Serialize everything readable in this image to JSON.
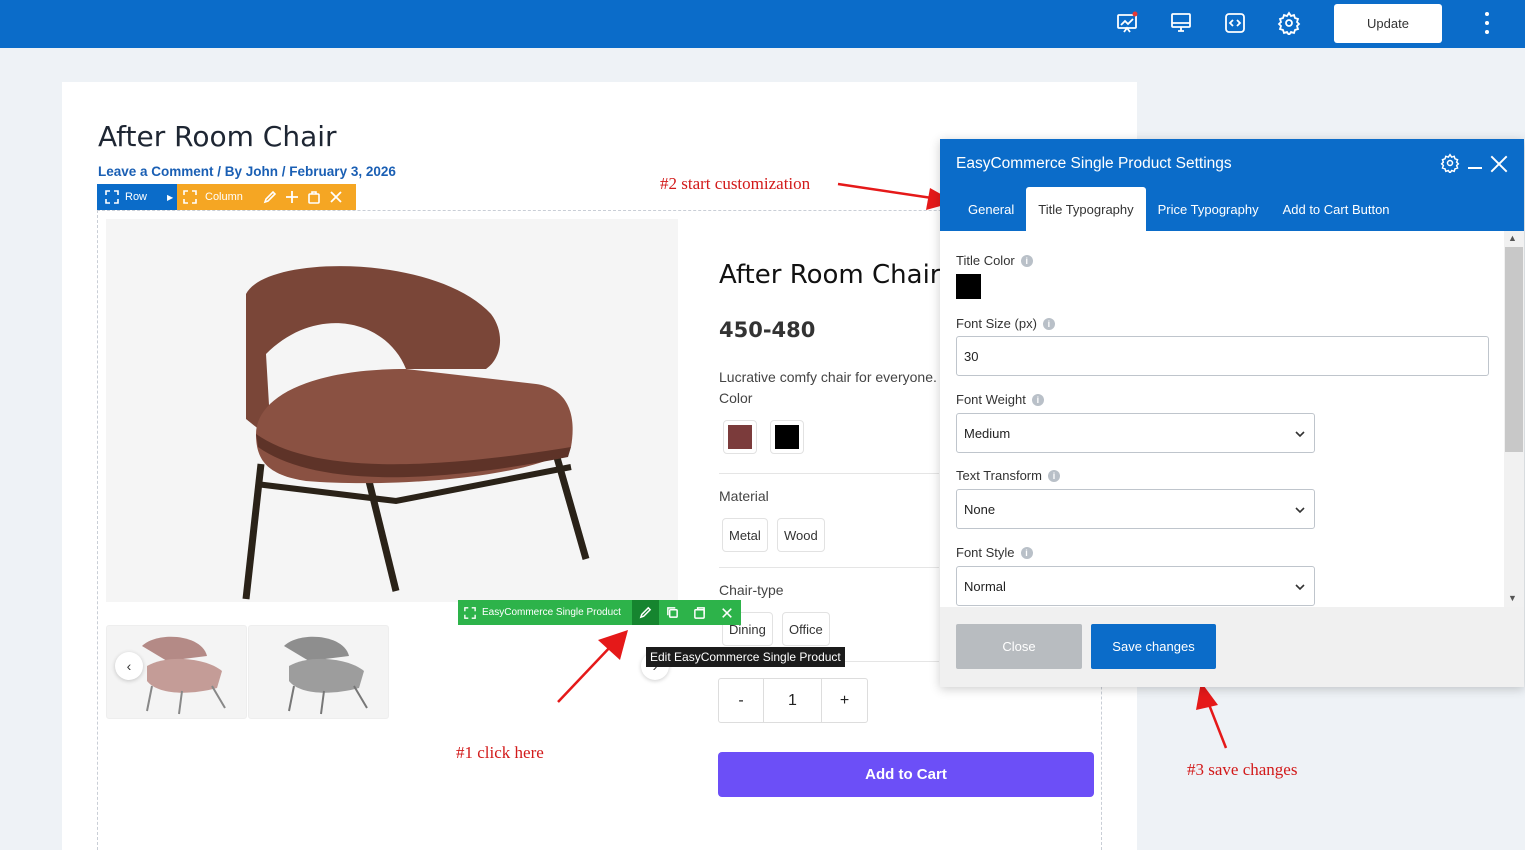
{
  "topbar": {
    "icons": [
      "analytics-icon",
      "desktop-preview-icon",
      "code-icon",
      "settings-gear-icon"
    ],
    "update_label": "Update"
  },
  "post": {
    "title": "After Room Chair",
    "meta": "Leave a Comment / By John / February 3, 2026"
  },
  "builder": {
    "row_label": "Row",
    "column_label": "Column",
    "widget_label": "EasyCommerce Single Product",
    "tooltip": "Edit EasyCommerce Single Product"
  },
  "product": {
    "title": "After Room Chair",
    "price": "450-480",
    "description": "Lucrative comfy chair for everyone.",
    "color_label": "Color",
    "colors": [
      "#7b3b3b",
      "#000000"
    ],
    "material_label": "Material",
    "materials": [
      "Metal",
      "Wood"
    ],
    "chair_type_label": "Chair-type",
    "chair_types": [
      "Dining",
      "Office"
    ],
    "qty_minus": "-",
    "qty_value": "1",
    "qty_plus": "+",
    "add_to_cart": "Add to Cart"
  },
  "annotations": {
    "step1": "#1 click here",
    "step2": "#2 start customization",
    "step3": "#3 save changes"
  },
  "panel": {
    "title": "EasyCommerce Single Product Settings",
    "tabs": [
      "General",
      "Title Typography",
      "Price Typography",
      "Add to Cart Button"
    ],
    "active_tab": "Title Typography",
    "title_color_label": "Title Color",
    "title_color": "#000000",
    "font_size_label": "Font Size (px)",
    "font_size_value": "30",
    "font_weight_label": "Font Weight",
    "font_weight_value": "Medium",
    "text_transform_label": "Text Transform",
    "text_transform_value": "None",
    "font_style_label": "Font Style",
    "font_style_value": "Normal",
    "close_label": "Close",
    "save_label": "Save changes"
  },
  "colors": {
    "brand_blue": "#0b6cc9",
    "column_orange": "#f5a623",
    "widget_green": "#2db34a",
    "cart_purple": "#6c4ff7",
    "annotation_red": "#d21a1a"
  }
}
